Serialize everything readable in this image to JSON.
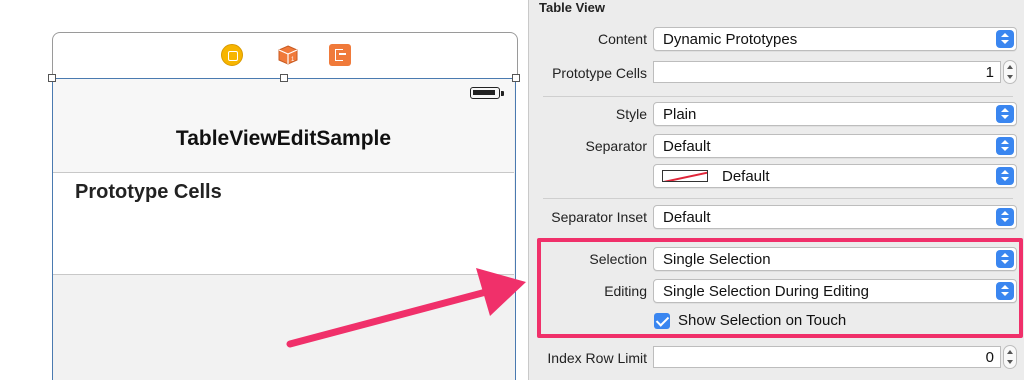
{
  "canvas": {
    "nav_title": "TableViewEditSample",
    "prototype_cells_label": "Prototype Cells"
  },
  "inspector": {
    "section_title": "Table View",
    "content": {
      "label": "Content",
      "value": "Dynamic Prototypes"
    },
    "prototype_cells": {
      "label": "Prototype Cells",
      "value": "1"
    },
    "style": {
      "label": "Style",
      "value": "Plain"
    },
    "separator": {
      "label": "Separator",
      "value": "Default",
      "color_value": "Default"
    },
    "separator_inset": {
      "label": "Separator Inset",
      "value": "Default"
    },
    "selection": {
      "label": "Selection",
      "value": "Single Selection"
    },
    "editing": {
      "label": "Editing",
      "value": "Single Selection During Editing"
    },
    "show_selection_on_touch": {
      "label": "Show Selection on Touch",
      "checked": true
    },
    "index_row_limit": {
      "label": "Index Row Limit",
      "value": "0"
    }
  },
  "colors": {
    "accent_blue": "#3a86f0",
    "highlight_pink": "#f0306a",
    "arrow_pink": "#f0306a",
    "view_controller_yellow": "#f7b500",
    "first_responder_orange": "#f07a3a",
    "exit_orange": "#f07a3a"
  },
  "icons": {
    "scene_dock": [
      "view-controller-icon",
      "first-responder-icon",
      "exit-icon"
    ],
    "popup": "popup-arrows-icon",
    "stepper": "stepper-icon",
    "checkbox": "checkmark-icon"
  }
}
